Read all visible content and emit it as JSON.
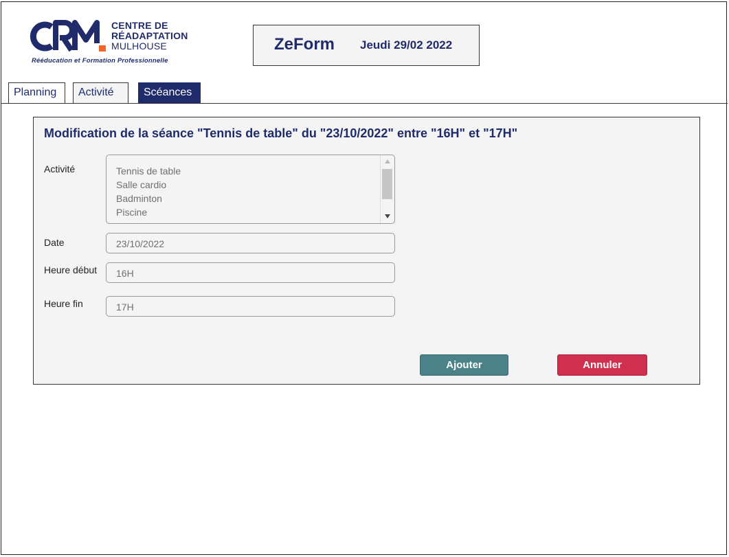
{
  "logo": {
    "line1": "CENTRE DE",
    "line2": "RÉADAPTATION",
    "line3": "MULHOUSE",
    "tagline": "Rééducation et Formation Professionnelle",
    "brand_color": "#1f2b6b",
    "accent_color": "#f26522"
  },
  "header": {
    "app_name": "ZeForm",
    "date": "Jeudi 29/02 2022"
  },
  "tabs": [
    {
      "label": "Planning"
    },
    {
      "label": "Activité"
    },
    {
      "label": "Scéances"
    }
  ],
  "form": {
    "title": "Modification de la séance \"Tennis de table\" du \"23/10/2022\" entre \"16H\" et \"17H\"",
    "activite": {
      "label": "Activité",
      "options": [
        "Tennis de table",
        "Salle cardio",
        "Badminton",
        "Piscine"
      ]
    },
    "date": {
      "label": "Date",
      "value": "23/10/2022"
    },
    "heure_debut": {
      "label": "Heure début",
      "value": "16H"
    },
    "heure_fin": {
      "label": "Heure fin",
      "value": "17H"
    },
    "add_label": "Ajouter",
    "cancel_label": "Annuler"
  },
  "colors": {
    "primary": "#1f2b6b",
    "add_button": "#4a8288",
    "cancel_button": "#d0304f"
  }
}
